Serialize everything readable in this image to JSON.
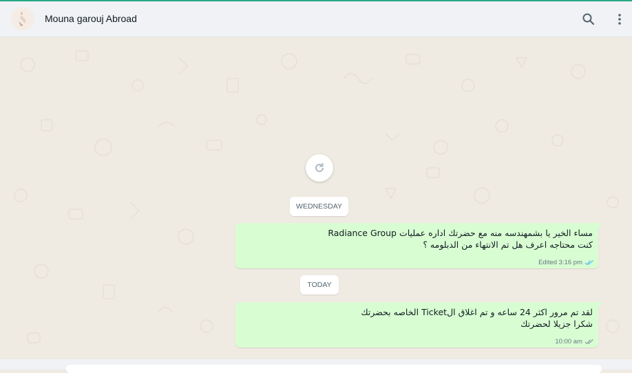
{
  "header": {
    "contact_name": "Mouna garouj Abroad",
    "icons": [
      "search-icon",
      "menu-dots-icon"
    ]
  },
  "colors": {
    "accent": "#25a884",
    "outgoing_bubble": "#d9fdd3",
    "chat_background": "#efeae2",
    "read_ticks": "#53bdeb"
  },
  "chat": {
    "date_wednesday": "WEDNESDAY",
    "date_today": "TODAY",
    "messages": [
      {
        "text": "مساء الخير يا بشمهندسه منه مع حضرتك اداره عمليات Radiance Group\nكنت محتاجه اعرف هل تم الانتهاء من الدبلومه ؟",
        "meta": "Edited 3:16 pm",
        "status": "read"
      },
      {
        "text": "لقد تم مرور اكثر  24 ساعه و تم اغلاق الTicket الخاصه بحضرتك\nشكرا جزيلا لحضرتك",
        "meta": "10:00 am",
        "status": "delivered"
      }
    ]
  }
}
